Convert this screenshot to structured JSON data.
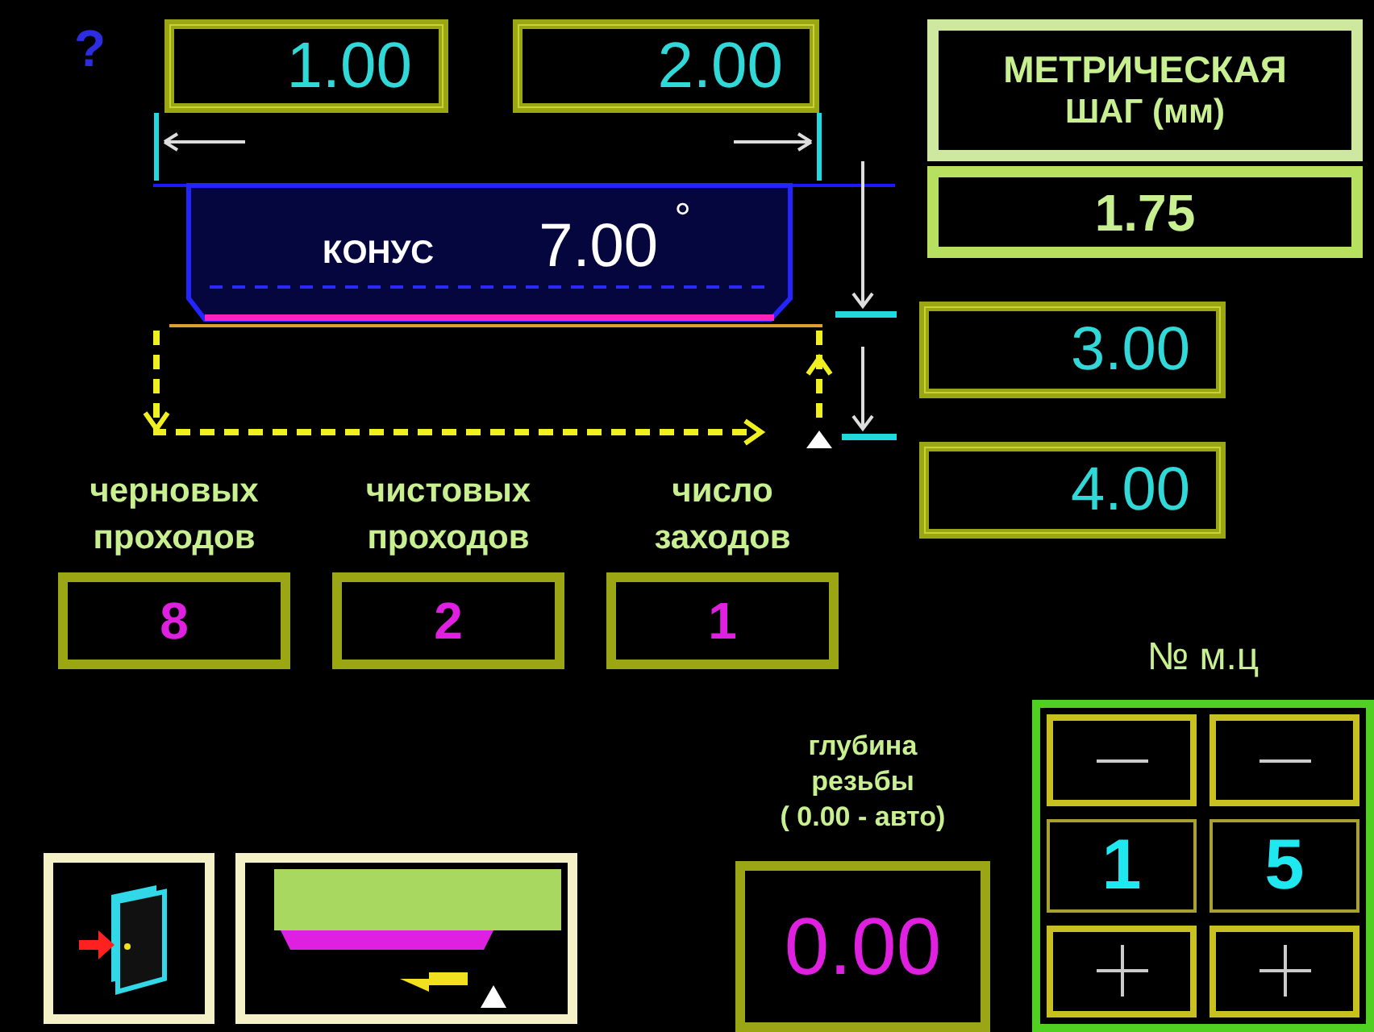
{
  "help": "?",
  "dimension_fields": [
    {
      "value": "1.00"
    },
    {
      "value": "2.00"
    }
  ],
  "cone": {
    "label": "КОНУС",
    "angle": "7.00",
    "unit": "°"
  },
  "thread": {
    "title": "МЕТРИЧЕСКАЯ",
    "subtitle": "ШАГ (мм)",
    "pitch": "1.75"
  },
  "depth_fields": [
    {
      "value": "3.00"
    },
    {
      "value": "4.00"
    }
  ],
  "passes": [
    {
      "label": "черновых проходов",
      "value": "8"
    },
    {
      "label": "чистовых проходов",
      "value": "2"
    },
    {
      "label": "число заходов",
      "value": "1"
    }
  ],
  "thread_depth": {
    "label_lines": [
      "глубина",
      "резьбы",
      "( 0.00 - авто)"
    ],
    "value": "0.00"
  },
  "cycle_counter": {
    "label": "№ м.ц",
    "digits": [
      {
        "value": "1"
      },
      {
        "value": "5"
      }
    ]
  }
}
